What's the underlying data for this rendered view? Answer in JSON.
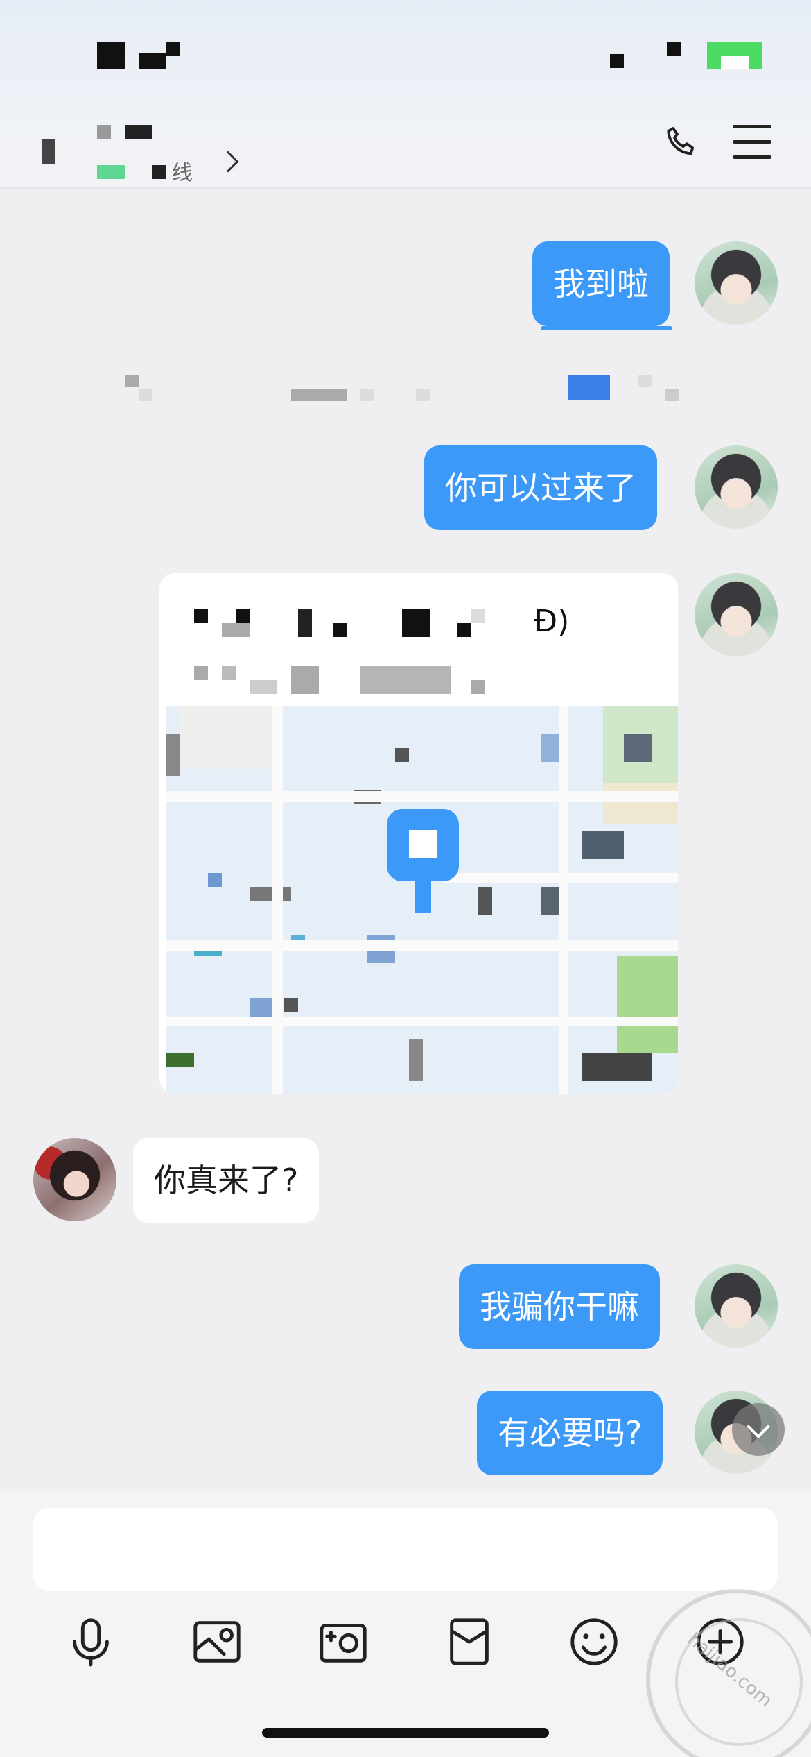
{
  "header": {
    "subtitle": "线",
    "phone_icon": "phone-icon",
    "menu_icon": "menu-icon"
  },
  "messages": [
    {
      "from": "me",
      "text": "我到啦"
    },
    {
      "from": "me",
      "text": "你可以过来了"
    },
    {
      "from": "me",
      "type": "location"
    },
    {
      "from": "other",
      "text": "你真来了?"
    },
    {
      "from": "me",
      "text": "我骗你干嘛"
    },
    {
      "from": "me",
      "text": "有必要吗?"
    }
  ],
  "location_card": {
    "title_tail": "Ð)",
    "pin_color": "#3d99f7"
  },
  "colors": {
    "bubble_me": "#3d99f7",
    "bubble_other": "#ffffff",
    "background": "#efeff1"
  },
  "toolbar": {
    "icons": [
      "microphone-icon",
      "image-icon",
      "camera-icon",
      "red-packet-icon",
      "emoji-icon",
      "plus-icon"
    ]
  },
  "watermark": {
    "text": "haijiao.com"
  }
}
